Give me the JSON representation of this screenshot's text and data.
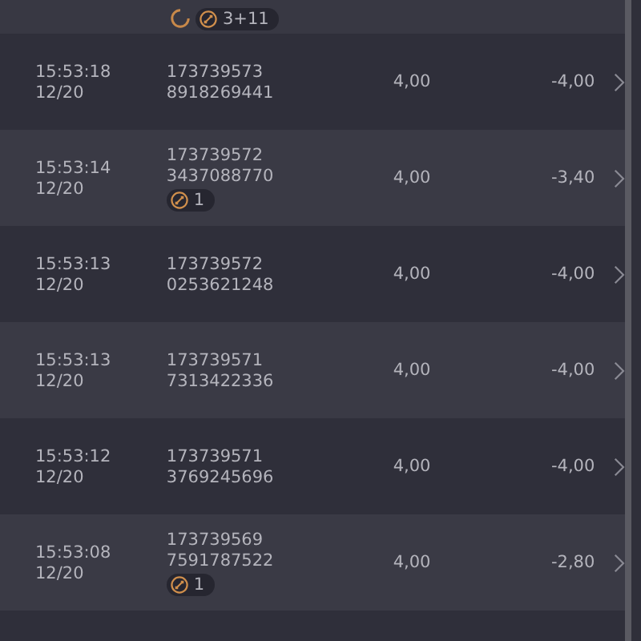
{
  "top_row": {
    "spinner": true,
    "badge": "3+11"
  },
  "rows": [
    {
      "time": "15:53:18",
      "date": "12/20",
      "id_1": "173739573",
      "id_2": "8918269441",
      "amount": "4,00",
      "result": "-4,00"
    },
    {
      "time": "15:53:14",
      "date": "12/20",
      "id_1": "173739572",
      "id_2": "3437088770",
      "badge": "1",
      "amount": "4,00",
      "result": "-3,40"
    },
    {
      "time": "15:53:13",
      "date": "12/20",
      "id_1": "173739572",
      "id_2": "0253621248",
      "amount": "4,00",
      "result": "-4,00"
    },
    {
      "time": "15:53:13",
      "date": "12/20",
      "id_1": "173739571",
      "id_2": "7313422336",
      "amount": "4,00",
      "result": "-4,00"
    },
    {
      "time": "15:53:12",
      "date": "12/20",
      "id_1": "173739571",
      "id_2": "3769245696",
      "amount": "4,00",
      "result": "-4,00"
    },
    {
      "time": "15:53:08",
      "date": "12/20",
      "id_1": "173739569",
      "id_2": "7591787522",
      "badge": "1",
      "amount": "4,00",
      "result": "-2,80"
    }
  ]
}
